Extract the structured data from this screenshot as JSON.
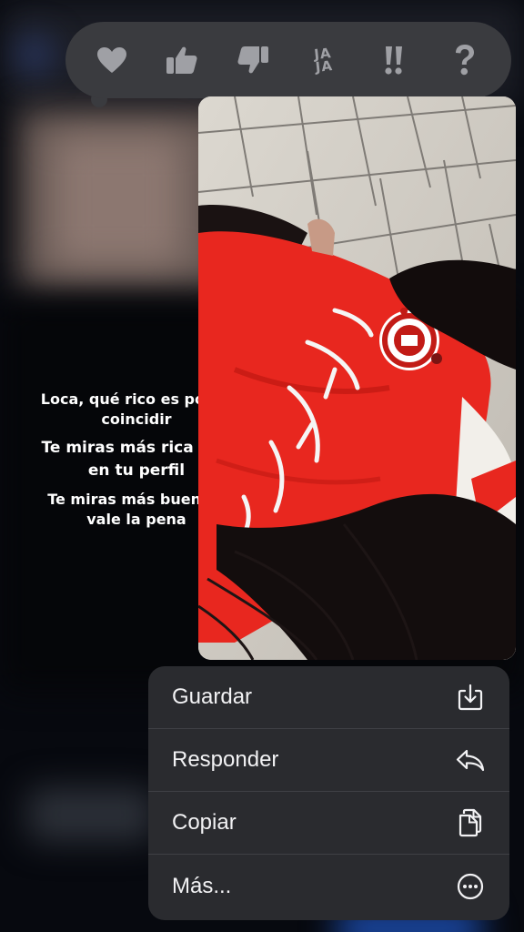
{
  "reactions": [
    {
      "icon": "heart-icon"
    },
    {
      "icon": "thumbs-up-icon"
    },
    {
      "icon": "thumbs-down-icon"
    },
    {
      "icon": "haha-icon",
      "label_top": "JA",
      "label_bottom": "JA"
    },
    {
      "icon": "double-exclamation-icon"
    },
    {
      "icon": "question-icon"
    }
  ],
  "lyrics": {
    "line1": "Loca, qué rico es poder coincidir",
    "line2": "Te miras más rica que en tu perfil",
    "line3": "Te miras más buena y vale la pena"
  },
  "menu": {
    "items": [
      {
        "label": "Guardar",
        "icon": "save-download-icon"
      },
      {
        "label": "Responder",
        "icon": "reply-icon"
      },
      {
        "label": "Copiar",
        "icon": "copy-icon"
      },
      {
        "label": "Más...",
        "icon": "more-ellipsis-icon"
      }
    ]
  },
  "colors": {
    "background": "#07090f",
    "reaction_bar": "#3a3b3f",
    "reaction_icon": "#9fa0a5",
    "menu_background": "#2a2b2f",
    "menu_text": "#f2f2f4",
    "jersey_red": "#e8271f"
  }
}
